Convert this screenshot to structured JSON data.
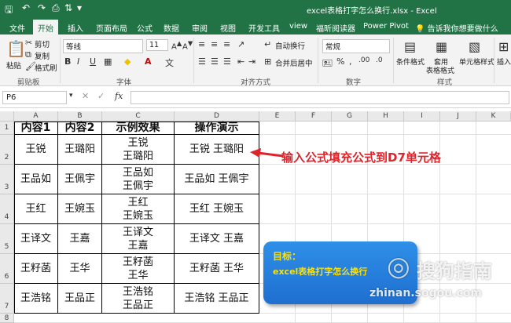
{
  "window": {
    "title": "excel表格打字怎么换行.xlsx - Excel"
  },
  "tabs": [
    "文件",
    "开始",
    "插入",
    "页面布局",
    "公式",
    "数据",
    "审阅",
    "视图",
    "开发工具",
    "view",
    "福昕阅读器",
    "Power Pivot"
  ],
  "tell_me": "告诉我你想要做什么",
  "ribbon": {
    "paste": "粘贴",
    "cut": "剪切",
    "copy": "复制",
    "format_painter": "格式刷",
    "clipboard": "剪贴板",
    "font_name": "等线",
    "font_size": "11",
    "font_group": "字体",
    "wrap_text": "自动换行",
    "merge_center": "合并后居中",
    "align_group": "对齐方式",
    "number_format": "常规",
    "number_group": "数字",
    "conditional_format": "条件格式",
    "table_format_1": "套用",
    "table_format_2": "表格格式",
    "cell_style": "单元格样式",
    "style_group": "样式",
    "insert": "插入"
  },
  "formula_bar": {
    "name_box": "P6",
    "fx": "fx"
  },
  "columns": [
    "A",
    "B",
    "C",
    "D",
    "E",
    "F",
    "G",
    "H",
    "I",
    "J",
    "K"
  ],
  "rows": [
    "1",
    "2",
    "3",
    "4",
    "5",
    "6",
    "7",
    "8"
  ],
  "table": {
    "headers": [
      "内容1",
      "内容2",
      "示例效果",
      "操作演示"
    ],
    "rows": [
      [
        "王锐",
        "王璐阳",
        "王锐\n王璐阳",
        "王锐 王璐阳"
      ],
      [
        "王品如",
        "王佩宇",
        "王品如\n王佩宇",
        "王品如 王佩宇"
      ],
      [
        "王红",
        "王婉玉",
        "王红\n王婉玉",
        "王红 王婉玉"
      ],
      [
        "王译文",
        "王嘉",
        "王译文\n王嘉",
        "王译文 王嘉"
      ],
      [
        "王籽菡",
        "王华",
        "王籽菡\n王华",
        "王籽菡 王华"
      ],
      [
        "王浩铭",
        "王品正",
        "王浩铭\n王品正",
        "王浩铭 王品正"
      ]
    ]
  },
  "annotation": "输入公式填充公式到D7单元格",
  "goal": {
    "title": "目标：",
    "text": "excel表格打字怎么换行"
  },
  "watermark": {
    "brand": "搜狗指南",
    "url": "zhinan.sogou.com"
  },
  "colors": {
    "excel_green": "#217346",
    "annotation_red": "#e0232a",
    "goal_blue": "#2e8fe8",
    "goal_text": "#ffe000"
  }
}
